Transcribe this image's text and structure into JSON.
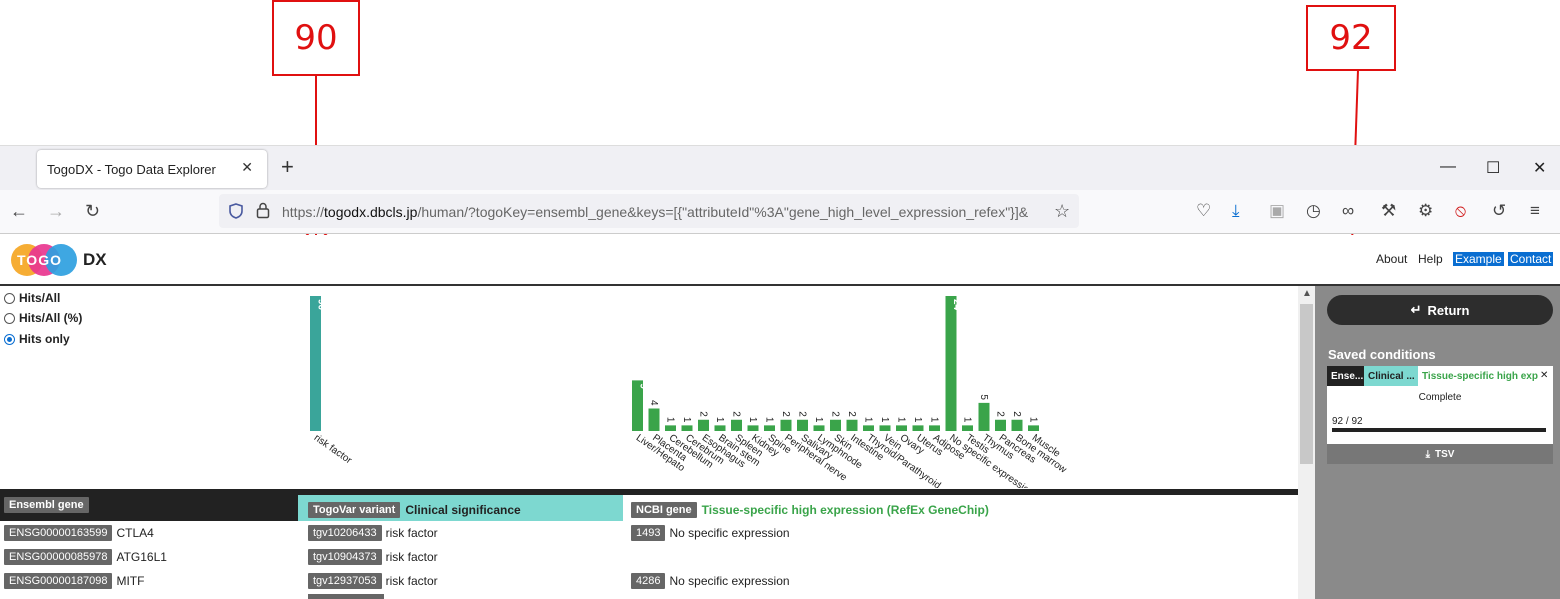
{
  "callouts": [
    {
      "label": "90"
    },
    {
      "label": "92"
    }
  ],
  "browser": {
    "tab_title": "TogoDX - Togo Data Explorer",
    "tab_close": "✕",
    "new_tab": "+",
    "win_minimize": "—",
    "win_maximize": "☐",
    "win_close": "✕",
    "url_prefix": "https://",
    "url_host": "togodx.dbcls.jp",
    "url_path": "/human/?togoKey=ensembl_gene&keys=[{\"attributeId\"%3A\"gene_high_level_expression_refex\"}]&"
  },
  "app": {
    "logo_text": "TOGO",
    "logo_suffix": "DX",
    "nav": {
      "about": "About",
      "help": "Help",
      "example": "Example",
      "contact": "Contact"
    },
    "colors": {
      "teal": "#3aa59a",
      "green": "#3aa44a",
      "dark": "#222222",
      "highlight": "#0a6ed1"
    }
  },
  "display_modes": [
    {
      "label": "Hits/All",
      "selected": false
    },
    {
      "label": "Hits/All (%)",
      "selected": false
    },
    {
      "label": "Hits only",
      "selected": true
    }
  ],
  "chart_data": [
    {
      "type": "bar",
      "categories": [
        "risk factor"
      ],
      "values": [
        90
      ],
      "color": "#3aa59a"
    },
    {
      "type": "bar",
      "categories": [
        "Liver/Hepato",
        "Placenta",
        "Cerebellum",
        "Cerebrum",
        "Esophagus",
        "Brain stem",
        "Spleen",
        "Kidney",
        "Spine",
        "Peripheral nerve",
        "Salivary",
        "Lymphnode",
        "Skin",
        "Intestine",
        "Thyroid/Parathyroid",
        "Vein",
        "Ovary",
        "Uterus",
        "Adipose",
        "No specific expression",
        "Testis",
        "Thymus",
        "Pancreas",
        "Bone marrow",
        "Muscle"
      ],
      "values": [
        9,
        4,
        1,
        1,
        2,
        1,
        2,
        1,
        1,
        2,
        2,
        1,
        2,
        2,
        1,
        1,
        1,
        1,
        1,
        24,
        1,
        5,
        2,
        2,
        1
      ],
      "color": "#3aa44a"
    }
  ],
  "table": {
    "columns": [
      {
        "chip": "Ensembl gene",
        "title": ""
      },
      {
        "chip": "TogoVar variant",
        "title": "Clinical significance"
      },
      {
        "chip": "NCBI gene",
        "title": "Tissue-specific high expression (RefEx GeneChip)"
      }
    ],
    "rows": [
      {
        "gene_id": "ENSG00000163599",
        "gene_name": "CTLA4",
        "variant_id": "tgv10206433",
        "clinical": "risk factor",
        "ncbi_id": "1493",
        "expression": "No specific expression"
      },
      {
        "gene_id": "ENSG00000085978",
        "gene_name": "ATG16L1",
        "variant_id": "tgv10904373",
        "clinical": "risk factor",
        "ncbi_id": "",
        "expression": ""
      },
      {
        "gene_id": "ENSG00000187098",
        "gene_name": "MITF",
        "variant_id": "tgv12937053",
        "clinical": "risk factor",
        "ncbi_id": "4286",
        "expression": "No specific expression"
      }
    ]
  },
  "panel": {
    "return_label": "Return",
    "saved_title": "Saved conditions",
    "segments": [
      "Ense...",
      "Clinical ...",
      "Tissue-specific high exp..."
    ],
    "remove": "✕",
    "status": "Complete",
    "count": "92 / 92",
    "progress": 1.0,
    "tsv_label": "TSV"
  }
}
